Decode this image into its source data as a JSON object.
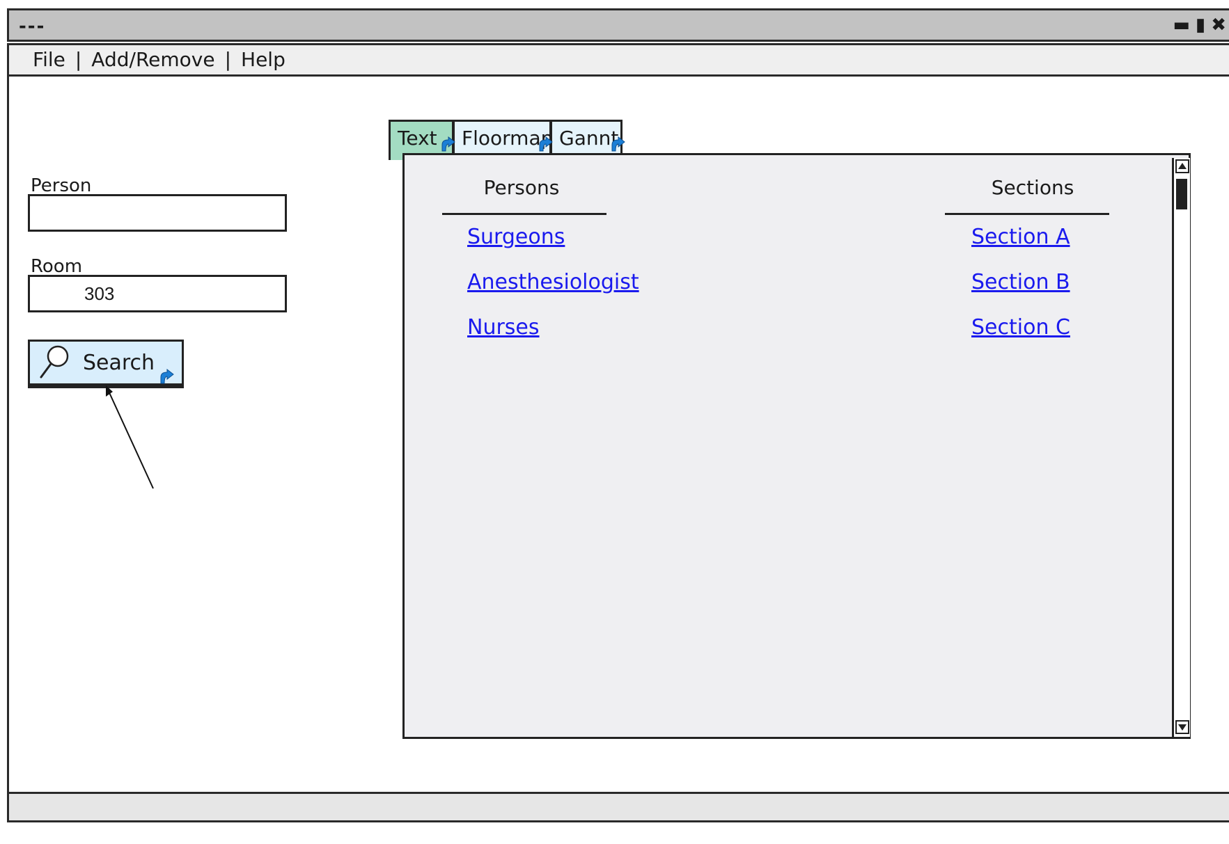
{
  "window": {
    "title": "---",
    "controls": {
      "minimize": "minimize-icon",
      "maximize": "maximize-icon",
      "close": "close-icon"
    }
  },
  "menu": {
    "items": [
      {
        "label": "File"
      },
      {
        "label": "Add/Remove"
      },
      {
        "label": "Help"
      }
    ],
    "separator": "|"
  },
  "form": {
    "person": {
      "label": "Person",
      "value": ""
    },
    "room": {
      "label": "Room",
      "value": "303"
    },
    "search_button": {
      "label": "Search",
      "icon": "magnifier-icon"
    }
  },
  "tabs": [
    {
      "label": "Text",
      "active": true
    },
    {
      "label": "Floormap",
      "active": false
    },
    {
      "label": "Gannt",
      "active": false
    }
  ],
  "panel": {
    "persons": {
      "header": "Persons",
      "links": [
        "Surgeons",
        "Anesthesiologist",
        "Nurses"
      ]
    },
    "sections": {
      "header": "Sections",
      "links": [
        "Section A",
        "Section B",
        "Section C"
      ]
    }
  },
  "colors": {
    "title_bar": "#c2c2c2",
    "active_tab": "#a3dcc2",
    "inactive_tab": "#e6f4fb",
    "panel_bg": "#efeff2",
    "link": "#1a1aee",
    "button_bg": "#d9eefc",
    "link_indicator": "#1c7fd6"
  }
}
